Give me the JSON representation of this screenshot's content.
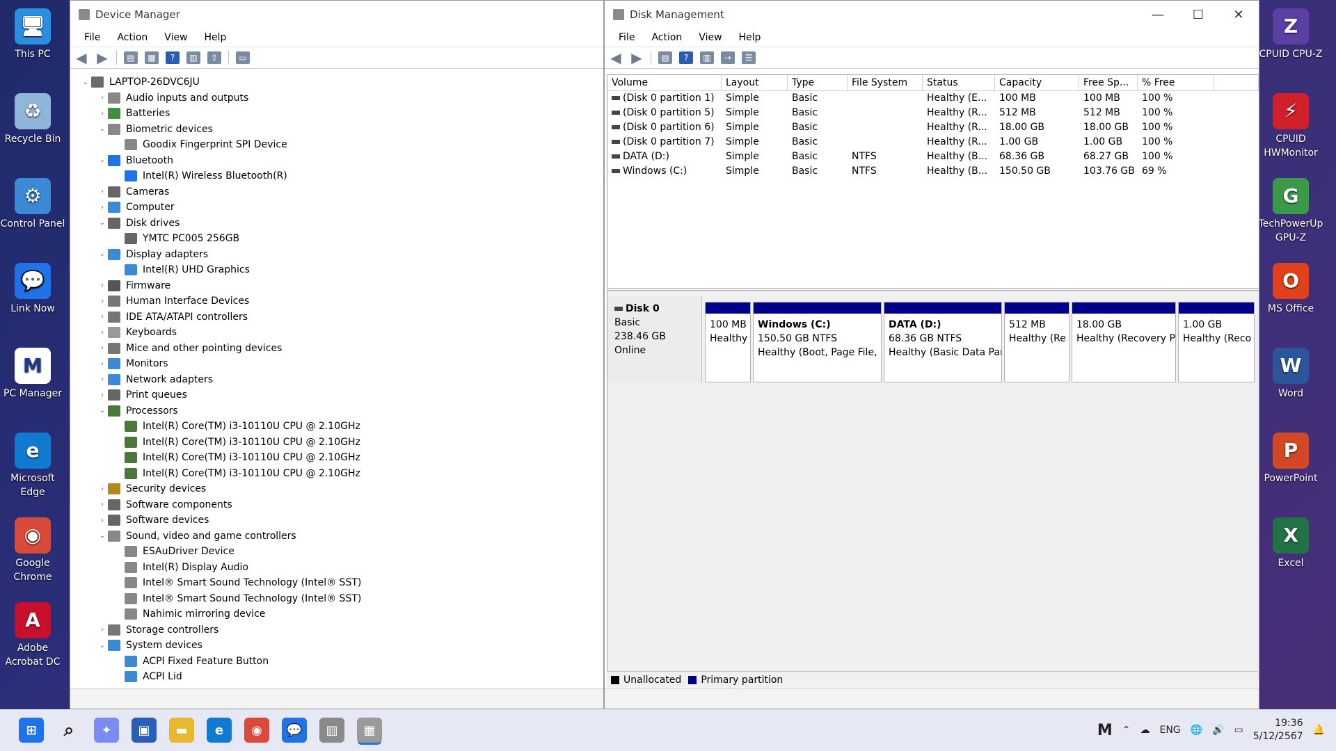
{
  "desktop_left": [
    {
      "label": "This PC",
      "color": "#2a8fe0",
      "glyph": "🖥"
    },
    {
      "label": "Recycle Bin",
      "color": "#8fb5d8",
      "glyph": "♻"
    },
    {
      "label": "Control Panel",
      "color": "#3a8ad6",
      "glyph": "⚙"
    },
    {
      "label": "Link Now",
      "color": "#1e73e8",
      "glyph": "💬"
    },
    {
      "label": "PC Manager",
      "color": "#ffffff",
      "glyph": "M"
    },
    {
      "label": "Microsoft Edge",
      "color": "#0f7bd0",
      "glyph": "e"
    },
    {
      "label": "Google Chrome",
      "color": "#d94a3a",
      "glyph": "◉"
    },
    {
      "label": "Adobe Acrobat DC",
      "color": "#c8102e",
      "glyph": "A"
    }
  ],
  "desktop_right": [
    {
      "label": "CPUID CPU-Z",
      "color": "#5b3fa3",
      "glyph": "Z"
    },
    {
      "label": "CPUID HWMonitor",
      "color": "#d0202a",
      "glyph": "⚡"
    },
    {
      "label": "TechPowerUp GPU-Z",
      "color": "#3a9a4a",
      "glyph": "G"
    },
    {
      "label": "MS Office",
      "color": "#e0401a",
      "glyph": "O"
    },
    {
      "label": "Word",
      "color": "#2b579a",
      "glyph": "W"
    },
    {
      "label": "PowerPoint",
      "color": "#d24726",
      "glyph": "P"
    },
    {
      "label": "Excel",
      "color": "#217346",
      "glyph": "X"
    }
  ],
  "device_manager": {
    "title": "Device Manager",
    "menu": [
      "File",
      "Action",
      "View",
      "Help"
    ],
    "tree": [
      {
        "level": 0,
        "chev": "⌄",
        "label": "LAPTOP-26DVC6JU",
        "color": "#6a6a6a"
      },
      {
        "level": 1,
        "chev": "›",
        "label": "Audio inputs and outputs",
        "color": "#888"
      },
      {
        "level": 1,
        "chev": "›",
        "label": "Batteries",
        "color": "#3f8f3f"
      },
      {
        "level": 1,
        "chev": "⌄",
        "label": "Biometric devices",
        "color": "#888"
      },
      {
        "level": 2,
        "chev": "",
        "label": "Goodix Fingerprint SPI Device",
        "color": "#888"
      },
      {
        "level": 1,
        "chev": "⌄",
        "label": "Bluetooth",
        "color": "#1e73e8"
      },
      {
        "level": 2,
        "chev": "",
        "label": "Intel(R) Wireless Bluetooth(R)",
        "color": "#1e73e8"
      },
      {
        "level": 1,
        "chev": "›",
        "label": "Cameras",
        "color": "#666"
      },
      {
        "level": 1,
        "chev": "›",
        "label": "Computer",
        "color": "#3a8ad6"
      },
      {
        "level": 1,
        "chev": "⌄",
        "label": "Disk drives",
        "color": "#666"
      },
      {
        "level": 2,
        "chev": "",
        "label": "YMTC PC005 256GB",
        "color": "#666"
      },
      {
        "level": 1,
        "chev": "⌄",
        "label": "Display adapters",
        "color": "#3a8ad6"
      },
      {
        "level": 2,
        "chev": "",
        "label": "Intel(R) UHD Graphics",
        "color": "#3a8ad6"
      },
      {
        "level": 1,
        "chev": "›",
        "label": "Firmware",
        "color": "#555"
      },
      {
        "level": 1,
        "chev": "›",
        "label": "Human Interface Devices",
        "color": "#777"
      },
      {
        "level": 1,
        "chev": "›",
        "label": "IDE ATA/ATAPI controllers",
        "color": "#777"
      },
      {
        "level": 1,
        "chev": "›",
        "label": "Keyboards",
        "color": "#999"
      },
      {
        "level": 1,
        "chev": "›",
        "label": "Mice and other pointing devices",
        "color": "#777"
      },
      {
        "level": 1,
        "chev": "›",
        "label": "Monitors",
        "color": "#3a8ad6"
      },
      {
        "level": 1,
        "chev": "›",
        "label": "Network adapters",
        "color": "#3a8ad6"
      },
      {
        "level": 1,
        "chev": "›",
        "label": "Print queues",
        "color": "#666"
      },
      {
        "level": 1,
        "chev": "⌄",
        "label": "Processors",
        "color": "#4a7a3a"
      },
      {
        "level": 2,
        "chev": "",
        "label": "Intel(R) Core(TM) i3-10110U CPU @ 2.10GHz",
        "color": "#4a7a3a"
      },
      {
        "level": 2,
        "chev": "",
        "label": "Intel(R) Core(TM) i3-10110U CPU @ 2.10GHz",
        "color": "#4a7a3a"
      },
      {
        "level": 2,
        "chev": "",
        "label": "Intel(R) Core(TM) i3-10110U CPU @ 2.10GHz",
        "color": "#4a7a3a"
      },
      {
        "level": 2,
        "chev": "",
        "label": "Intel(R) Core(TM) i3-10110U CPU @ 2.10GHz",
        "color": "#4a7a3a"
      },
      {
        "level": 1,
        "chev": "›",
        "label": "Security devices",
        "color": "#b08a20"
      },
      {
        "level": 1,
        "chev": "›",
        "label": "Software components",
        "color": "#666"
      },
      {
        "level": 1,
        "chev": "›",
        "label": "Software devices",
        "color": "#666"
      },
      {
        "level": 1,
        "chev": "⌄",
        "label": "Sound, video and game controllers",
        "color": "#888"
      },
      {
        "level": 2,
        "chev": "",
        "label": "ESAuDriver Device",
        "color": "#888"
      },
      {
        "level": 2,
        "chev": "",
        "label": "Intel(R) Display Audio",
        "color": "#888"
      },
      {
        "level": 2,
        "chev": "",
        "label": "Intel® Smart Sound Technology (Intel® SST)",
        "color": "#888"
      },
      {
        "level": 2,
        "chev": "",
        "label": "Intel® Smart Sound Technology (Intel® SST)",
        "color": "#888"
      },
      {
        "level": 2,
        "chev": "",
        "label": "Nahimic mirroring device",
        "color": "#888"
      },
      {
        "level": 1,
        "chev": "›",
        "label": "Storage controllers",
        "color": "#777"
      },
      {
        "level": 1,
        "chev": "⌄",
        "label": "System devices",
        "color": "#3a8ad6"
      },
      {
        "level": 2,
        "chev": "",
        "label": "ACPI Fixed Feature Button",
        "color": "#3a8ad6"
      },
      {
        "level": 2,
        "chev": "",
        "label": "ACPI Lid",
        "color": "#3a8ad6"
      }
    ]
  },
  "disk_management": {
    "title": "Disk Management",
    "menu": [
      "File",
      "Action",
      "View",
      "Help"
    ],
    "controls": {
      "minimize": "—",
      "maximize": "☐",
      "close": "✕"
    },
    "columns": [
      "Volume",
      "Layout",
      "Type",
      "File System",
      "Status",
      "Capacity",
      "Free Sp...",
      "% Free"
    ],
    "rows": [
      [
        "(Disk 0 partition 1)",
        "Simple",
        "Basic",
        "",
        "Healthy (E...",
        "100 MB",
        "100 MB",
        "100 %"
      ],
      [
        "(Disk 0 partition 5)",
        "Simple",
        "Basic",
        "",
        "Healthy (R...",
        "512 MB",
        "512 MB",
        "100 %"
      ],
      [
        "(Disk 0 partition 6)",
        "Simple",
        "Basic",
        "",
        "Healthy (R...",
        "18.00 GB",
        "18.00 GB",
        "100 %"
      ],
      [
        "(Disk 0 partition 7)",
        "Simple",
        "Basic",
        "",
        "Healthy (R...",
        "1.00 GB",
        "1.00 GB",
        "100 %"
      ],
      [
        "DATA (D:)",
        "Simple",
        "Basic",
        "NTFS",
        "Healthy (B...",
        "68.36 GB",
        "68.27 GB",
        "100 %"
      ],
      [
        "Windows (C:)",
        "Simple",
        "Basic",
        "NTFS",
        "Healthy (B...",
        "150.50 GB",
        "103.76 GB",
        "69 %"
      ]
    ],
    "disk": {
      "name": "Disk 0",
      "type": "Basic",
      "size": "238.46 GB",
      "state": "Online"
    },
    "partitions": [
      {
        "title": "",
        "line1": "100 MB",
        "line2": "Healthy"
      },
      {
        "title": "Windows  (C:)",
        "line1": "150.50 GB NTFS",
        "line2": "Healthy (Boot, Page File,"
      },
      {
        "title": "DATA  (D:)",
        "line1": "68.36 GB NTFS",
        "line2": "Healthy (Basic Data Par"
      },
      {
        "title": "",
        "line1": "512 MB",
        "line2": "Healthy (Re"
      },
      {
        "title": "",
        "line1": "18.00 GB",
        "line2": "Healthy (Recovery P"
      },
      {
        "title": "",
        "line1": "1.00 GB",
        "line2": "Healthy (Reco"
      }
    ],
    "legend": {
      "unallocated": "Unallocated",
      "primary": "Primary partition"
    }
  },
  "taskbar": {
    "lang": "ENG",
    "time": "19:36",
    "date": "5/12/2567"
  },
  "colors": {
    "primary_partition": "#00008b",
    "unallocated": "#000000"
  }
}
